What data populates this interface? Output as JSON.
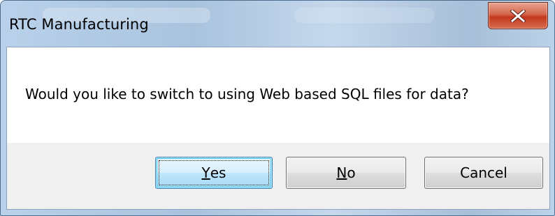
{
  "window": {
    "title": "RTC Manufacturing",
    "close_icon": "close-icon"
  },
  "message": {
    "text": "Would you like to switch to using Web based SQL files for data?"
  },
  "buttons": {
    "yes": {
      "mnemonic": "Y",
      "rest": "es"
    },
    "no": {
      "mnemonic": "N",
      "rest": "o"
    },
    "cancel": {
      "label": "Cancel"
    }
  },
  "colors": {
    "close_button": "#c3381d",
    "default_button_border": "#3c7fb1"
  }
}
